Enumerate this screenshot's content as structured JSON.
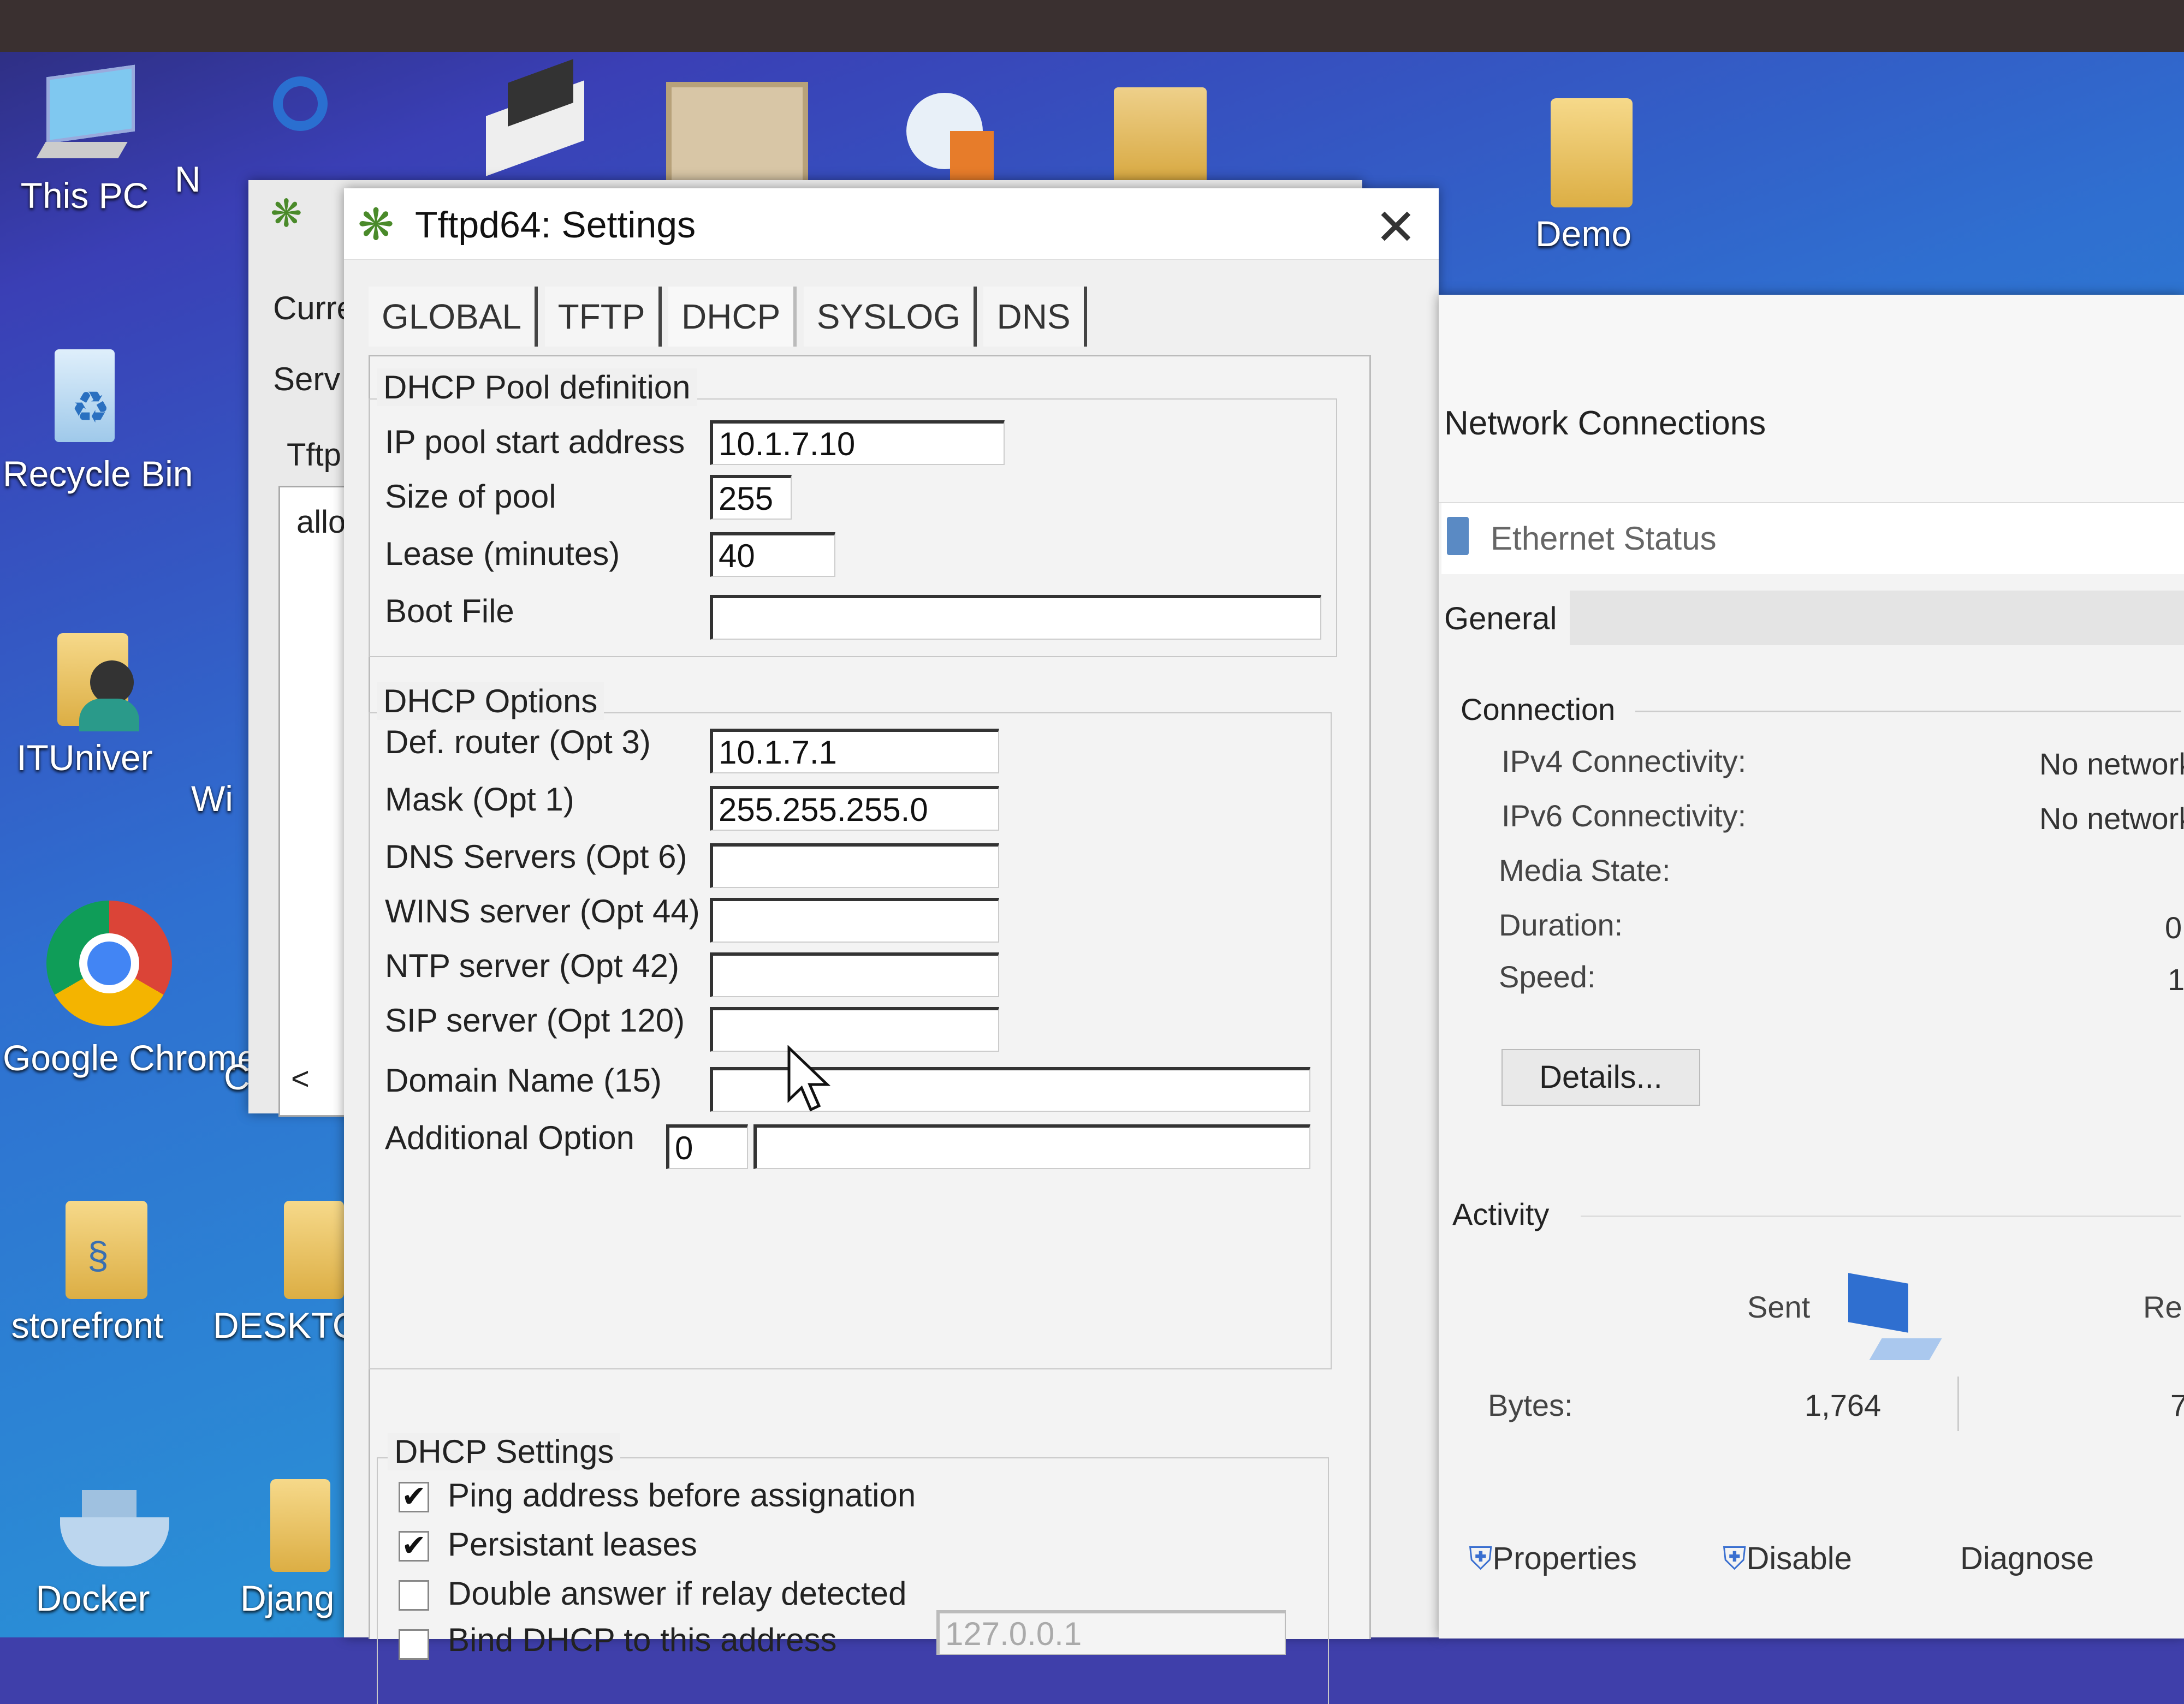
{
  "desktop": {
    "icons": [
      {
        "label": "This PC",
        "icon": "computer-icon"
      },
      {
        "label": "N",
        "icon": "network-icon"
      },
      {
        "label": "Recycle Bin",
        "icon": "recycle-bin-icon"
      },
      {
        "label": "ITUniver",
        "icon": "user-folder-icon"
      },
      {
        "label": "Wi",
        "icon": "app-icon"
      },
      {
        "label": "Google Chrome",
        "icon": "chrome-icon"
      },
      {
        "label": "C",
        "icon": "app-icon"
      },
      {
        "label": "storefront",
        "icon": "python-folder-icon"
      },
      {
        "label": "DESKTO",
        "icon": "folder-icon"
      },
      {
        "label": "Docker",
        "icon": "docker-icon"
      },
      {
        "label": "Djang",
        "icon": "folder-icon"
      },
      {
        "label": "Demo",
        "icon": "folder-icon"
      }
    ]
  },
  "bg_window": {
    "fragments": [
      "Curre",
      "Serv",
      "Tftp",
      "allo",
      "<"
    ]
  },
  "settings": {
    "title": "Tftpd64: Settings",
    "tabs": [
      "GLOBAL",
      "TFTP",
      "DHCP",
      "SYSLOG",
      "DNS"
    ],
    "active_tab": "DHCP",
    "pool": {
      "group_title": "DHCP Pool definition",
      "start_label": "IP pool start address",
      "start_value": "10.1.7.10",
      "size_label": "Size of pool",
      "size_value": "255",
      "lease_label": "Lease (minutes)",
      "lease_value": "40",
      "boot_label": "Boot File",
      "boot_value": ""
    },
    "options": {
      "group_title": "DHCP Options",
      "router_label": "Def. router (Opt 3)",
      "router_value": "10.1.7.1",
      "mask_label": "Mask (Opt 1)",
      "mask_value": "255.255.255.0",
      "dns_label": "DNS Servers (Opt 6)",
      "wins_label": "WINS server (Opt 44)",
      "ntp_label": "NTP server (Opt 42)",
      "sip_label": "SIP server (Opt 120)",
      "domain_label": "Domain Name (15)",
      "additional_label": "Additional Option",
      "additional_value": "0"
    },
    "dhcp_settings": {
      "group_title": "DHCP Settings",
      "ping_label": "Ping address before assignation",
      "ping_checked": true,
      "persist_label": "Persistant leases",
      "persist_checked": true,
      "double_label": "Double answer if relay detected",
      "double_checked": false,
      "bind_label": "Bind DHCP to this address",
      "bind_checked": false,
      "bind_value": "127.0.0.1"
    }
  },
  "network": {
    "title": "Network Connections",
    "status_title": "Ethernet Status",
    "tab": "General",
    "connection_header": "Connection",
    "ipv4_label": "IPv4 Connectivity:",
    "ipv4_value": "No network",
    "ipv6_label": "IPv6 Connectivity:",
    "ipv6_value": "No network",
    "media_label": "Media State:",
    "duration_label": "Duration:",
    "duration_value": "0",
    "speed_label": "Speed:",
    "speed_value": "1",
    "details_button": "Details...",
    "activity_header": "Activity",
    "sent_label": "Sent",
    "received_label": "Re",
    "bytes_label": "Bytes:",
    "bytes_sent": "1,764",
    "bytes_received": "7",
    "properties_button": "Properties",
    "disable_button": "Disable",
    "diagnose_button": "Diagnose"
  }
}
